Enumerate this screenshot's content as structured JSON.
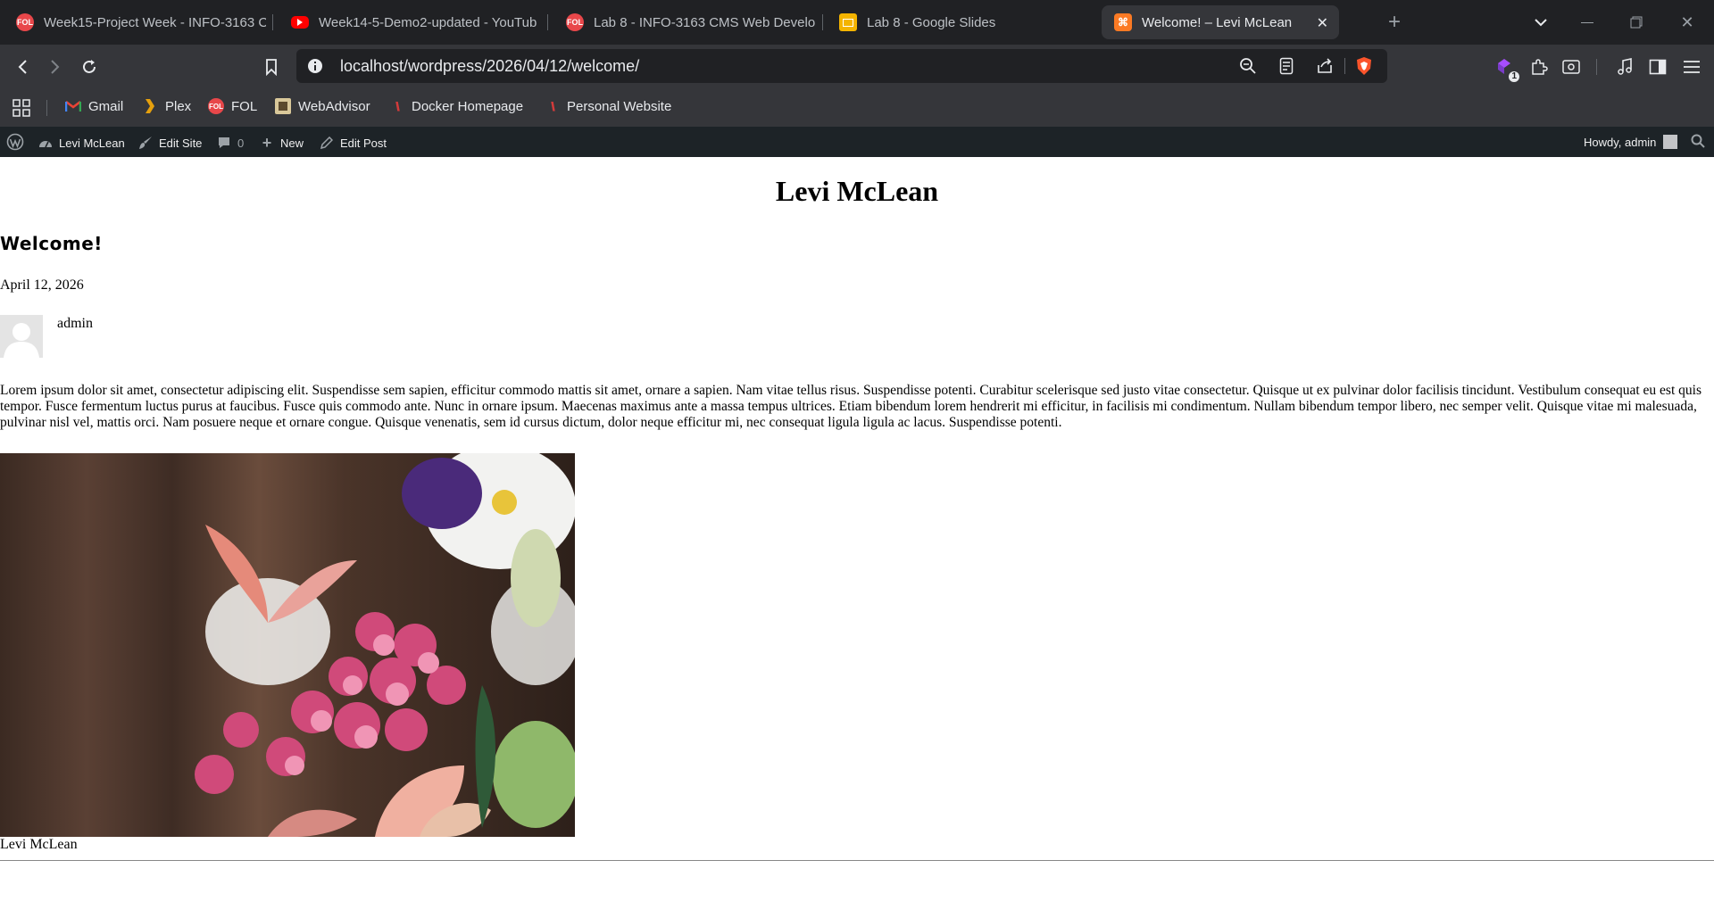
{
  "browser": {
    "tabs": [
      {
        "title": "Week15-Project Week - INFO-3163 C",
        "icon": "fol-icon",
        "color": "#e8474a"
      },
      {
        "title": "Week14-5-Demo2-updated - YouTub",
        "icon": "youtube-icon",
        "color": "#ff0000"
      },
      {
        "title": "Lab 8 - INFO-3163 CMS Web Develo",
        "icon": "fol-icon",
        "color": "#e8474a"
      },
      {
        "title": "Lab 8 - Google Slides",
        "icon": "slides-icon",
        "color": "#f4b400"
      },
      {
        "title": "Welcome! – Levi McLean",
        "icon": "xampp-icon",
        "color": "#fb7a24"
      }
    ],
    "url": "localhost/wordpress/2026/04/12/welcome/",
    "extensions_badge": "1",
    "bookmarks": [
      {
        "label": "Gmail"
      },
      {
        "label": "Plex"
      },
      {
        "label": "FOL"
      },
      {
        "label": "WebAdvisor"
      },
      {
        "label": "Docker Homepage"
      },
      {
        "label": "Personal Website"
      }
    ]
  },
  "wp_admin_bar": {
    "site_name": "Levi McLean",
    "edit_site": "Edit Site",
    "comments_count": "0",
    "new": "New",
    "edit_post": "Edit Post",
    "howdy": "Howdy, admin"
  },
  "page": {
    "site_title": "Levi McLean",
    "post_title": "Welcome!",
    "date": "April 12, 2026",
    "author": "admin",
    "body": "Lorem ipsum dolor sit amet, consectetur adipiscing elit. Suspendisse sem sapien, efficitur commodo mattis sit amet, ornare a sapien. Nam vitae tellus risus. Suspendisse potenti. Curabitur scelerisque sed justo vitae consectetur. Quisque ut ex pulvinar dolor facilisis tincidunt. Vestibulum consequat eu est quis tempor. Fusce fermentum luctus purus at faucibus. Fusce quis commodo ante. Nunc in ornare ipsum. Maecenas maximus ante a massa tempus ultrices. Etiam bibendum lorem hendrerit mi efficitur, in facilisis mi condimentum. Nullam bibendum tempor libero, nec semper velit. Quisque vitae mi malesuada, pulvinar nisl vel, mattis orci. Nam posuere neque et ornare congue. Quisque venenatis, sem id cursus dictum, dolor neque efficitur mi, nec consequat ligula ligula ac lacus. Suspendisse potenti.",
    "footer_name": "Levi McLean"
  }
}
